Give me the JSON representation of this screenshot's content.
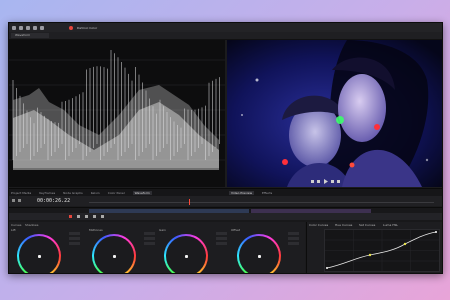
{
  "window": {
    "title": "DaVinci Color"
  },
  "preset": {
    "label": "Waveform"
  },
  "tabs_left": [
    "Project Media",
    "Keyframes",
    "Node Graphs",
    "Kelvin",
    "Color Panel",
    "Waveform"
  ],
  "tabs_left_active": "Waveform",
  "tabs_right": [
    "Video Preview",
    "Effects"
  ],
  "tabs_right_active": "Video Preview",
  "timecode": "00:00:26.22",
  "wheels_panel": {
    "tabs": [
      "Curves",
      "Shadows",
      "Midtones",
      "Highlights",
      "Lift",
      "Gain",
      "Offset"
    ]
  },
  "curves_panel": {
    "tabs": [
      "Color Curves",
      "Hue Curves",
      "Sat Curves",
      "Luma HSL"
    ]
  },
  "colors": {
    "accent": "#e6463c",
    "curve_point": "#e9e34a",
    "window": "#1b1b1d"
  }
}
